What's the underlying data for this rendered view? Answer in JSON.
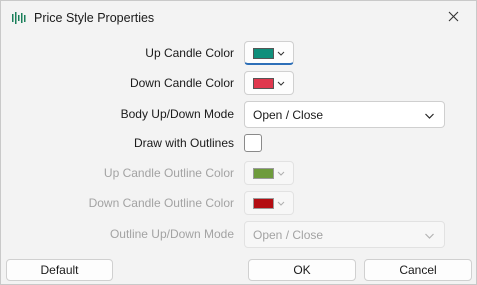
{
  "window": {
    "title": "Price Style Properties",
    "icon": "candlestick-chart-icon",
    "close_icon": "close-icon"
  },
  "rows": {
    "up_candle_color": {
      "label": "Up Candle Color",
      "color": "#0f8f7b"
    },
    "down_candle_color": {
      "label": "Down Candle Color",
      "color": "#e0384e"
    },
    "body_mode": {
      "label": "Body Up/Down Mode",
      "value": "Open / Close"
    },
    "draw_outlines": {
      "label": "Draw with Outlines",
      "checked": false
    },
    "up_outline_color": {
      "label": "Up Candle Outline Color",
      "color": "#6e9b3c",
      "enabled": false
    },
    "down_outline_color": {
      "label": "Down Candle Outline Color",
      "color": "#b30d12",
      "enabled": false
    },
    "outline_mode": {
      "label": "Outline Up/Down Mode",
      "value": "Open / Close",
      "enabled": false
    }
  },
  "buttons": {
    "default": "Default",
    "ok": "OK",
    "cancel": "Cancel"
  }
}
